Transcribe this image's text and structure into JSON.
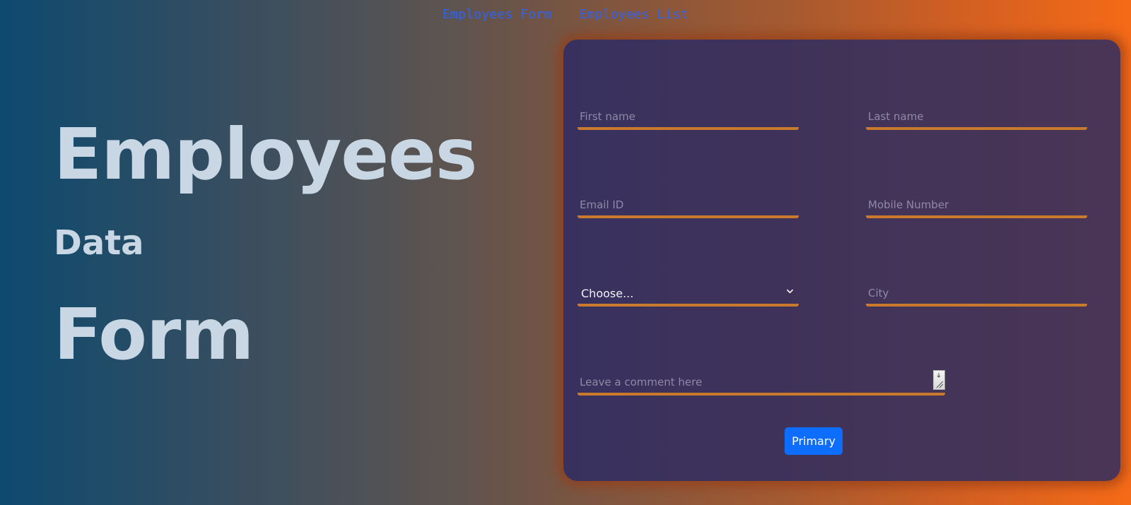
{
  "nav": {
    "items": [
      {
        "label": "Employees Form"
      },
      {
        "label": "Employees List"
      }
    ]
  },
  "hero": {
    "line1": "Employees",
    "line2": "Data",
    "line3": "Form"
  },
  "form": {
    "first_name": {
      "placeholder": "First name",
      "value": ""
    },
    "last_name": {
      "placeholder": "Last name",
      "value": ""
    },
    "email": {
      "placeholder": "Email ID",
      "value": ""
    },
    "mobile": {
      "placeholder": "Mobile Number",
      "value": ""
    },
    "select": {
      "selected": "Choose..."
    },
    "city": {
      "placeholder": "City",
      "value": ""
    },
    "comment": {
      "placeholder": "Leave a comment here",
      "value": ""
    },
    "submit_label": "Primary"
  },
  "colors": {
    "accent_underline": "#c97a2d",
    "button": "#0d6efd",
    "nav_link": "#2f63f0",
    "hero_text": "#c9d7e4"
  },
  "icons": {
    "select_chevron": "chevron-down-icon",
    "textarea_resize": "resize-grip-icon"
  }
}
